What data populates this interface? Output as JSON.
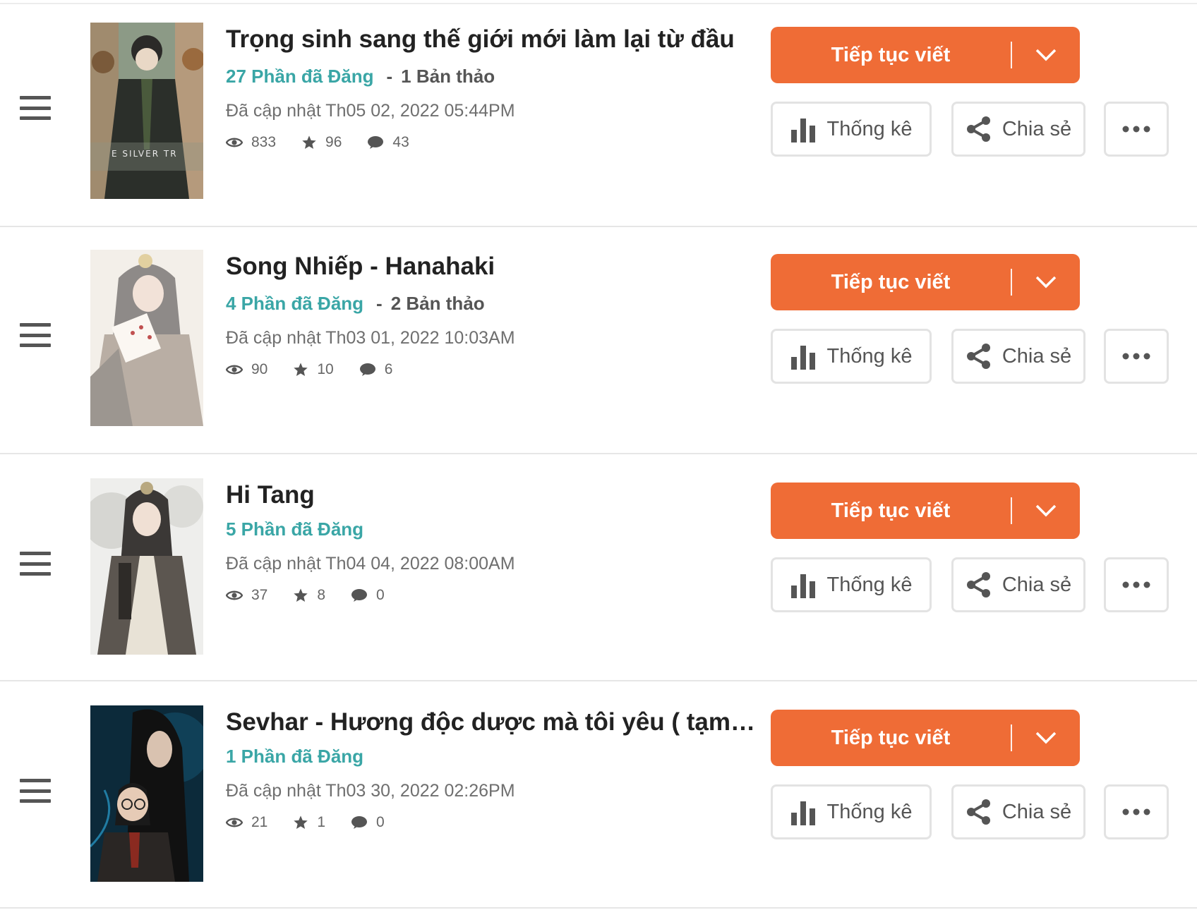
{
  "colors": {
    "accent": "#ef6c36",
    "published": "#3aa6a6",
    "muted": "#6f6f6f"
  },
  "actions": {
    "continue_label": "Tiếp tục viết",
    "stats_label": "Thống kê",
    "share_label": "Chia sẻ"
  },
  "stories": [
    {
      "title": "Trọng sinh sang thế giới mới làm lại từ đầu",
      "published": "27 Phần đã Đăng",
      "separator": "-",
      "drafts": "1 Bản thảo",
      "updated": "Đã cập nhật Th05 02, 2022 05:44PM",
      "views": "833",
      "votes": "96",
      "comments": "43",
      "cover_text": "E SILVER TR"
    },
    {
      "title": "Song Nhiếp - Hanahaki",
      "published": "4 Phần đã Đăng",
      "separator": "-",
      "drafts": "2 Bản thảo",
      "updated": "Đã cập nhật Th03 01, 2022 10:03AM",
      "views": "90",
      "votes": "10",
      "comments": "6"
    },
    {
      "title": "Hi Tang",
      "published": "5 Phần đã Đăng",
      "updated": "Đã cập nhật Th04 04, 2022 08:00AM",
      "views": "37",
      "votes": "8",
      "comments": "0"
    },
    {
      "title": "Sevhar - Hương độc dược mà tôi yêu ( tạm dro...",
      "published": "1 Phần đã Đăng",
      "updated": "Đã cập nhật Th03 30, 2022 02:26PM",
      "views": "21",
      "votes": "1",
      "comments": "0"
    }
  ]
}
